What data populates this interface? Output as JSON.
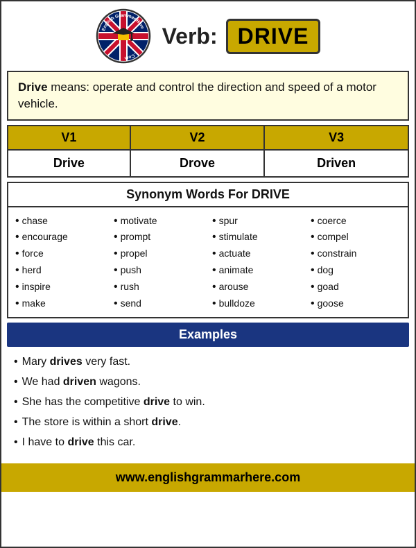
{
  "header": {
    "verb_label": "Verb:",
    "verb_word": "DRIVE",
    "logo_top_text": "English Grammar Here",
    "logo_bottom_text": ".Com"
  },
  "definition": {
    "bold_word": "Drive",
    "text": " means: operate and control the direction and speed of a motor vehicle."
  },
  "verb_forms": {
    "headers": [
      "V1",
      "V2",
      "V3"
    ],
    "values": [
      "Drive",
      "Drove",
      "Driven"
    ]
  },
  "synonyms": {
    "title_plain": "Synonym Words For ",
    "title_bold": "DRIVE",
    "columns": [
      [
        "chase",
        "encourage",
        "force",
        "herd",
        "inspire",
        "make"
      ],
      [
        "motivate",
        "prompt",
        "propel",
        "push",
        "rush",
        "send"
      ],
      [
        "spur",
        "stimulate",
        "actuate",
        "animate",
        "arouse",
        "bulldoze"
      ],
      [
        "coerce",
        "compel",
        "constrain",
        "dog",
        "goad",
        "goose"
      ]
    ]
  },
  "examples": {
    "section_title": "Examples",
    "items": [
      {
        "text": "Mary ",
        "bold": "drives",
        "rest": " very fast."
      },
      {
        "text": "We had ",
        "bold": "driven",
        "rest": " wagons."
      },
      {
        "text": "She has the competitive ",
        "bold": "drive",
        "rest": " to win."
      },
      {
        "text": "The store is within a short ",
        "bold": "drive",
        "rest": "."
      },
      {
        "text": "I have to ",
        "bold": "drive",
        "rest": " this car."
      }
    ]
  },
  "footer": {
    "url": "www.englishgrammarhere.com"
  }
}
